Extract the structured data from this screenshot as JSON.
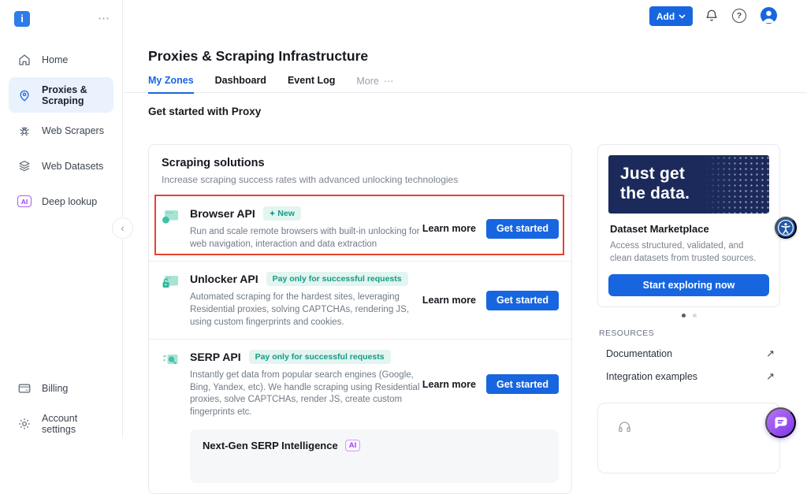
{
  "app": {
    "logo_letter": "i",
    "sidebar_menu_dots": "⋯",
    "collapse_chevron": "‹"
  },
  "sidebar": {
    "items": [
      {
        "label": "Home",
        "icon": "home-icon"
      },
      {
        "label": "Proxies & Scraping",
        "icon": "location-pin-icon"
      },
      {
        "label": "Web Scrapers",
        "icon": "spider-icon"
      },
      {
        "label": "Web Datasets",
        "icon": "layers-icon"
      },
      {
        "label": "Deep lookup",
        "icon": "ai-badge-icon",
        "icon_text": "AI"
      }
    ],
    "bottom_items": [
      {
        "label": "Billing",
        "icon": "credit-card-icon"
      },
      {
        "label": "Account settings",
        "icon": "gear-icon"
      }
    ]
  },
  "topbar": {
    "add_button": "Add",
    "help_glyph": "?"
  },
  "page": {
    "title": "Proxies & Scraping Infrastructure",
    "tabs": [
      {
        "label": "My Zones"
      },
      {
        "label": "Dashboard"
      },
      {
        "label": "Event Log"
      },
      {
        "label": "More",
        "trailing_dots": "⋯"
      }
    ],
    "section_heading": "Get started with Proxy"
  },
  "solutions": {
    "title": "Scraping solutions",
    "subtitle": "Increase scraping success rates with advanced unlocking technologies",
    "rows": [
      {
        "name": "Browser API",
        "badge_icon": "✦",
        "badge": "New",
        "description": "Run and scale remote browsers with built-in unlocking for web navigation, interaction and data extraction",
        "learn_more": "Learn more",
        "cta": "Get started"
      },
      {
        "name": "Unlocker API",
        "badge": "Pay only for successful requests",
        "description": "Automated scraping for the hardest sites, leveraging Residential proxies, solving CAPTCHAs, rendering JS, using custom fingerprints and cookies.",
        "learn_more": "Learn more",
        "cta": "Get started"
      },
      {
        "name": "SERP API",
        "badge": "Pay only for successful requests",
        "description": "Instantly get data from popular search engines (Google, Bing, Yandex, etc). We handle scraping using Residential proxies, solve CAPTCHAs, render JS, create custom fingerprints etc.",
        "learn_more": "Learn more",
        "cta": "Get started",
        "subcard": {
          "title": "Next-Gen SERP Intelligence",
          "badge": "AI"
        }
      }
    ]
  },
  "promo": {
    "banner_line1": "Just get",
    "banner_line2": "the data.",
    "title": "Dataset Marketplace",
    "description": "Access structured, validated, and clean datasets from trusted sources.",
    "cta": "Start exploring now",
    "carousel_dot_count": 2
  },
  "resources": {
    "heading": "RESOURCES",
    "links": [
      {
        "label": "Documentation",
        "arrow": "↗"
      },
      {
        "label": "Integration examples",
        "arrow": "↗"
      }
    ]
  },
  "colors": {
    "accent_blue": "#1766e0",
    "teal_badge_text": "#169a87",
    "teal_badge_bg": "#e2f5f0",
    "banner_navy": "#1b2a5a",
    "annotation_red": "#e8432d",
    "ai_purple": "#9a45f0",
    "accessibility_blue": "#2257a7",
    "chat_gradient_start": "#b775f3",
    "chat_gradient_end": "#7e36ea"
  }
}
